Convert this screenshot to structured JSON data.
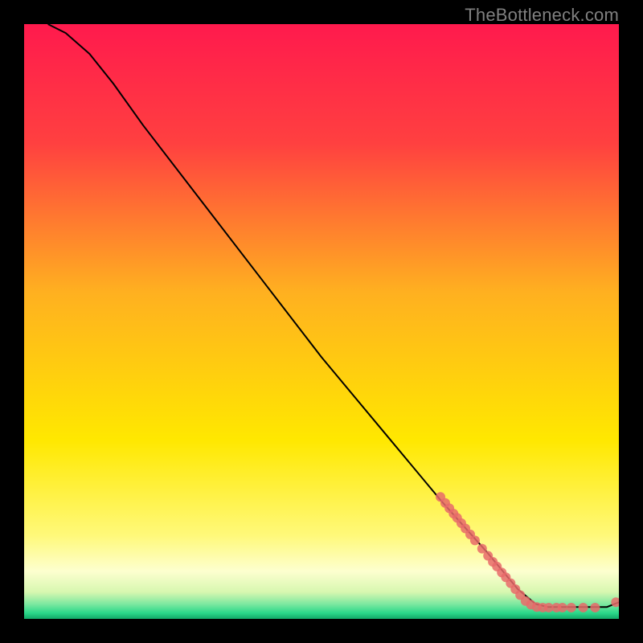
{
  "watermark": "TheBottleneck.com",
  "chart_data": {
    "type": "line",
    "title": "",
    "xlabel": "",
    "ylabel": "",
    "xlim": [
      0,
      100
    ],
    "ylim": [
      0,
      100
    ],
    "grid": false,
    "background_gradient_stops": [
      {
        "pos": 0.0,
        "color": "#ff1a4d"
      },
      {
        "pos": 0.2,
        "color": "#ff4040"
      },
      {
        "pos": 0.45,
        "color": "#ffb020"
      },
      {
        "pos": 0.7,
        "color": "#ffe800"
      },
      {
        "pos": 0.86,
        "color": "#fff97a"
      },
      {
        "pos": 0.92,
        "color": "#fdffcf"
      },
      {
        "pos": 0.955,
        "color": "#d7f7b0"
      },
      {
        "pos": 0.975,
        "color": "#7de8a0"
      },
      {
        "pos": 0.99,
        "color": "#2bd88a"
      },
      {
        "pos": 1.0,
        "color": "#12a868"
      }
    ],
    "curve": {
      "stroke": "#000000",
      "stroke_width": 2,
      "points": [
        {
          "x": 4,
          "y": 100
        },
        {
          "x": 7,
          "y": 98.5
        },
        {
          "x": 11,
          "y": 95
        },
        {
          "x": 15,
          "y": 90
        },
        {
          "x": 20,
          "y": 83
        },
        {
          "x": 30,
          "y": 70
        },
        {
          "x": 40,
          "y": 57
        },
        {
          "x": 50,
          "y": 44
        },
        {
          "x": 60,
          "y": 32
        },
        {
          "x": 70,
          "y": 20
        },
        {
          "x": 78,
          "y": 11
        },
        {
          "x": 83,
          "y": 5
        },
        {
          "x": 86,
          "y": 2.5
        },
        {
          "x": 88,
          "y": 2
        },
        {
          "x": 94,
          "y": 2
        },
        {
          "x": 98,
          "y": 2
        },
        {
          "x": 100,
          "y": 2.8
        }
      ]
    },
    "scatter": {
      "color": "#e86a6a",
      "radius": 6,
      "points": [
        {
          "x": 70,
          "y": 20.5
        },
        {
          "x": 70.8,
          "y": 19.5
        },
        {
          "x": 71.5,
          "y": 18.6
        },
        {
          "x": 72.2,
          "y": 17.7
        },
        {
          "x": 72.8,
          "y": 17.0
        },
        {
          "x": 73.5,
          "y": 16.1
        },
        {
          "x": 74.2,
          "y": 15.2
        },
        {
          "x": 75.0,
          "y": 14.2
        },
        {
          "x": 75.8,
          "y": 13.2
        },
        {
          "x": 77.0,
          "y": 11.8
        },
        {
          "x": 78.0,
          "y": 10.6
        },
        {
          "x": 78.8,
          "y": 9.6
        },
        {
          "x": 79.5,
          "y": 8.8
        },
        {
          "x": 80.3,
          "y": 7.8
        },
        {
          "x": 81.0,
          "y": 7.0
        },
        {
          "x": 81.8,
          "y": 6.0
        },
        {
          "x": 82.6,
          "y": 5.0
        },
        {
          "x": 83.4,
          "y": 4.0
        },
        {
          "x": 84.3,
          "y": 3.0
        },
        {
          "x": 85.2,
          "y": 2.4
        },
        {
          "x": 86.2,
          "y": 2.0
        },
        {
          "x": 87.2,
          "y": 1.9
        },
        {
          "x": 88.2,
          "y": 1.9
        },
        {
          "x": 89.5,
          "y": 1.9
        },
        {
          "x": 90.5,
          "y": 1.9
        },
        {
          "x": 92.0,
          "y": 1.9
        },
        {
          "x": 94.0,
          "y": 1.9
        },
        {
          "x": 96.0,
          "y": 1.9
        },
        {
          "x": 99.5,
          "y": 2.8
        }
      ]
    }
  }
}
